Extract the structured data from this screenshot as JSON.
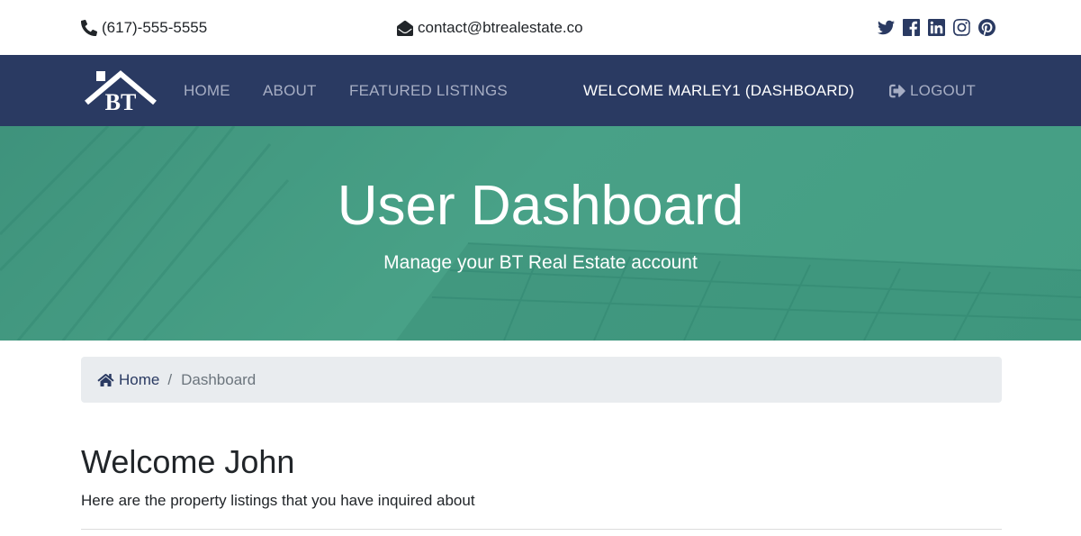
{
  "topbar": {
    "phone": "(617)-555-5555",
    "email": "contact@btrealestate.co",
    "social": [
      "twitter-icon",
      "facebook-icon",
      "linkedin-icon",
      "instagram-icon",
      "pinterest-icon"
    ]
  },
  "navbar": {
    "brand": "BT",
    "links": [
      "Home",
      "About",
      "Featured Listings"
    ],
    "welcome": "Welcome Marley1 (Dashboard)",
    "logout": "Logout"
  },
  "showcase": {
    "title": "User Dashboard",
    "subtitle": "Manage your BT Real Estate account"
  },
  "breadcrumb": {
    "home": "Home",
    "separator": "/",
    "current": "Dashboard"
  },
  "content": {
    "heading": "Welcome John",
    "text": "Here are the property listings that you have inquired about"
  },
  "colors": {
    "navbar": "#2a3a62",
    "showcase": "#4ea58a",
    "breadcrumb_bg": "#e9ecef"
  }
}
